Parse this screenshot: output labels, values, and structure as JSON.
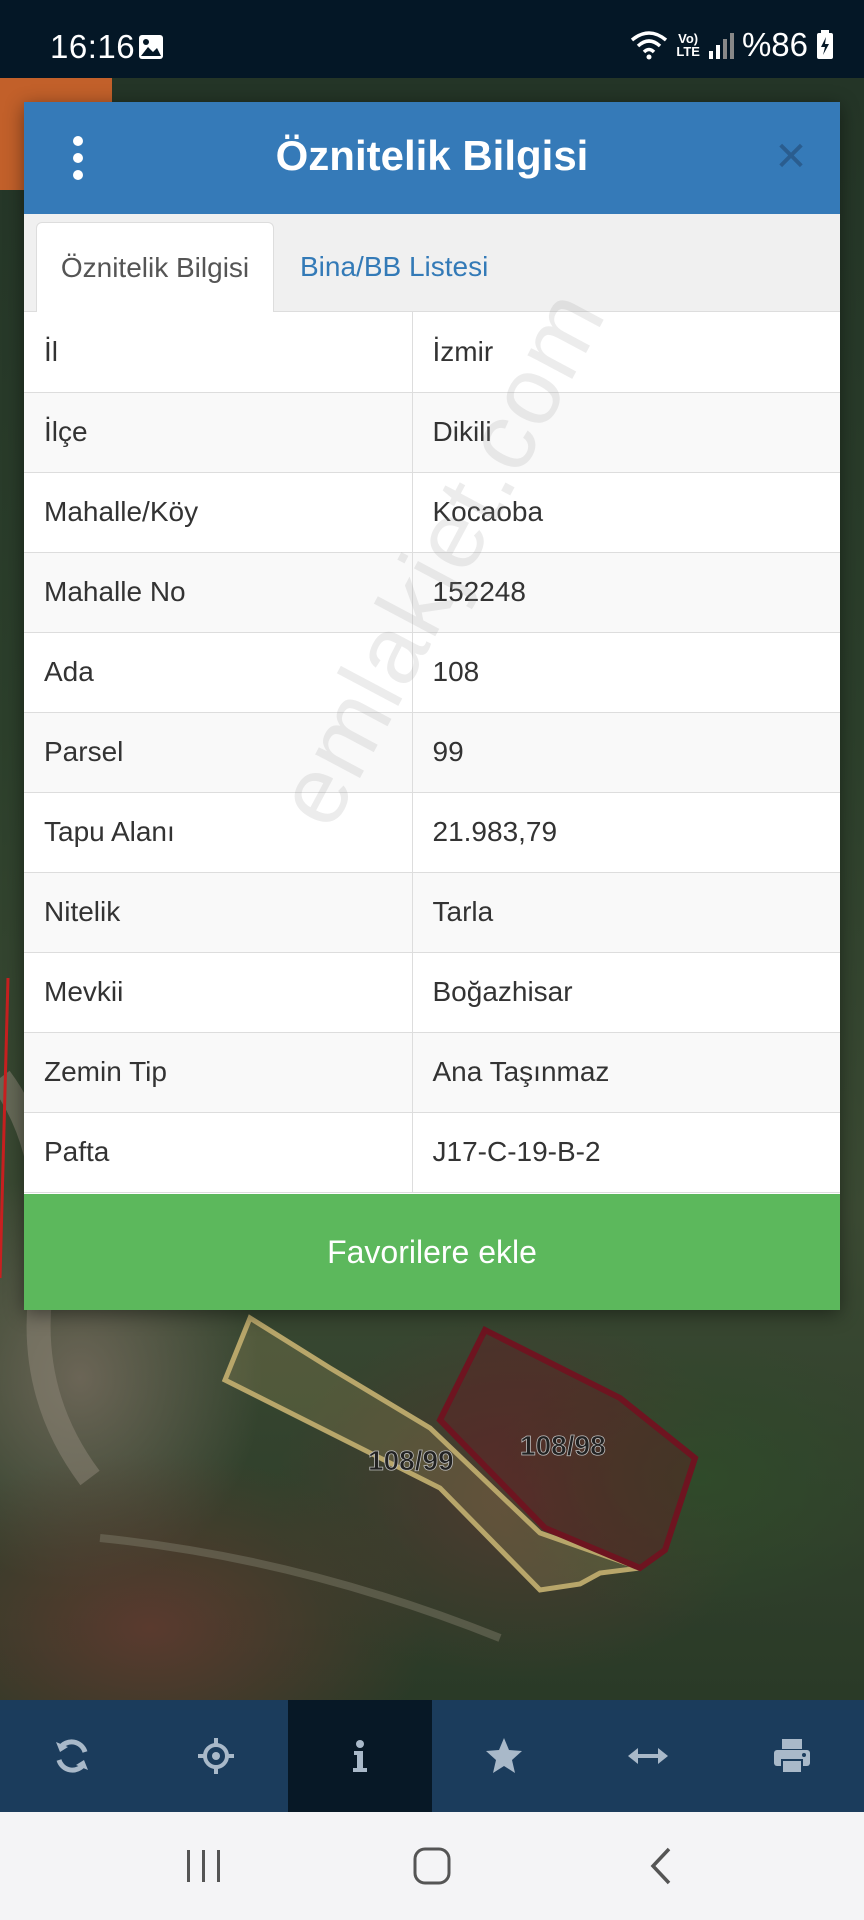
{
  "status_bar": {
    "time": "16:16",
    "battery": "%86",
    "network": "LTE"
  },
  "map": {
    "parcel_labels": [
      "108/99",
      "108/98"
    ],
    "colors": {
      "parcel_99": "#b8a66a",
      "parcel_98": "#6e1420"
    }
  },
  "dialog": {
    "title": "Öznitelik Bilgisi",
    "tabs": [
      {
        "label": "Öznitelik Bilgisi",
        "active": true
      },
      {
        "label": "Bina/BB Listesi",
        "active": false
      }
    ],
    "rows": [
      {
        "key": "İl",
        "value": "İzmir"
      },
      {
        "key": "İlçe",
        "value": "Dikili"
      },
      {
        "key": "Mahalle/Köy",
        "value": "Kocaoba"
      },
      {
        "key": "Mahalle No",
        "value": "152248"
      },
      {
        "key": "Ada",
        "value": "108"
      },
      {
        "key": "Parsel",
        "value": "99"
      },
      {
        "key": "Tapu Alanı",
        "value": "21.983,79"
      },
      {
        "key": "Nitelik",
        "value": "Tarla"
      },
      {
        "key": "Mevkii",
        "value": "Boğazhisar"
      },
      {
        "key": "Zemin Tip",
        "value": "Ana Taşınmaz"
      },
      {
        "key": "Pafta",
        "value": "J17-C-19-B-2"
      }
    ],
    "favorite_button": "Favorilere ekle",
    "watermark": "emlakjet.com",
    "colors": {
      "header": "#357ab8",
      "button": "#5cb85c"
    }
  },
  "toolbar": {
    "items": [
      "refresh-icon",
      "crosshair-icon",
      "info-icon",
      "star-icon",
      "arrows-horizontal-icon",
      "printer-icon"
    ],
    "active": "info-icon"
  }
}
